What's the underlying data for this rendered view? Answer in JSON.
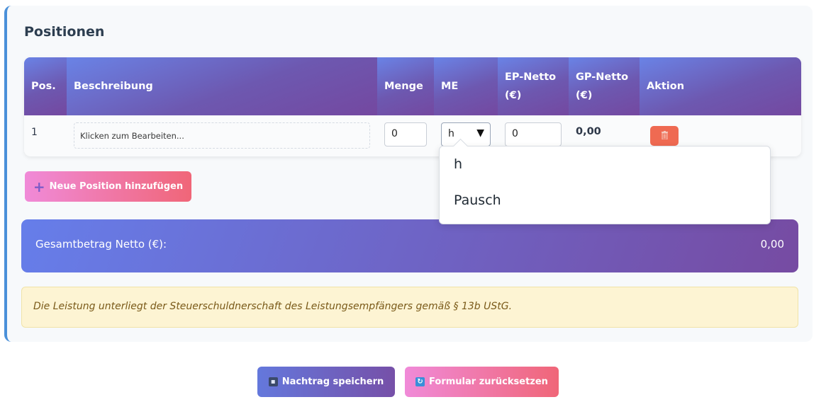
{
  "section": {
    "title": "Positionen"
  },
  "table": {
    "headers": [
      {
        "key": "pos",
        "label": "Pos."
      },
      {
        "key": "desc",
        "label": "Beschreibung"
      },
      {
        "key": "qty",
        "label": "Menge"
      },
      {
        "key": "unit",
        "label": "ME"
      },
      {
        "key": "ep",
        "label": "EP-Netto\n(€)"
      },
      {
        "key": "gp",
        "label": "GP-Netto\n(€)"
      },
      {
        "key": "action",
        "label": "Aktion"
      }
    ],
    "rows": [
      {
        "pos": "1",
        "description_placeholder": "Klicken zum Bearbeiten...",
        "quantity": "0",
        "unit": "h",
        "unit_price": "0",
        "total": "0,00",
        "delete_icon": "trash-icon"
      }
    ]
  },
  "unit_dropdown": {
    "options": [
      "h",
      "Pausch"
    ],
    "selected": "h"
  },
  "add_button": {
    "label": "Neue Position hinzufügen",
    "icon": "plus-icon"
  },
  "total": {
    "label": "Gesamtbetrag Netto (€):",
    "value": "0,00"
  },
  "notice": {
    "text": "Die Leistung unterliegt der Steuerschuldnerschaft des Leistungsempfängers gemäß § 13b UStG."
  },
  "actions": {
    "save_label": "Nachtrag speichern",
    "save_icon": "floppy-disk-icon",
    "reset_label": "Formular zurücksetzen",
    "reset_icon": "refresh-icon"
  },
  "colors": {
    "accent_gradient_start": "#667eea",
    "accent_gradient_end": "#764ba2",
    "pink_gradient_start": "#f08ad8",
    "pink_gradient_end": "#f06678",
    "delete": "#ef6a52",
    "notice_bg": "#fdf4d3"
  }
}
